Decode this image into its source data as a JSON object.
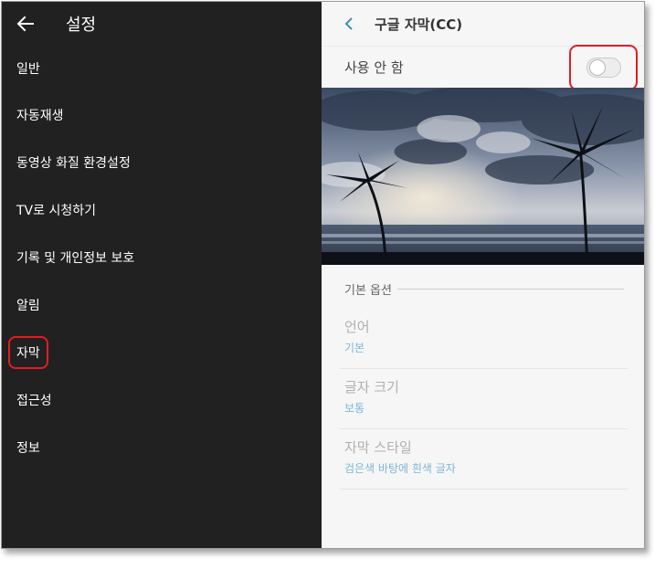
{
  "left": {
    "title": "설정",
    "items": [
      {
        "label": "일반"
      },
      {
        "label": "자동재생"
      },
      {
        "label": "동영상 화질 환경설정"
      },
      {
        "label": "TV로 시청하기"
      },
      {
        "label": "기록 및 개인정보 보호"
      },
      {
        "label": "알림"
      },
      {
        "label": "자막"
      },
      {
        "label": "접근성"
      },
      {
        "label": "정보"
      }
    ]
  },
  "right": {
    "title": "구글 자막(CC)",
    "toggle": {
      "label": "사용 안 함",
      "on": false
    },
    "section_label": "기본 옵션",
    "options": [
      {
        "title": "언어",
        "value": "기본"
      },
      {
        "title": "글자 크기",
        "value": "보통"
      },
      {
        "title": "자막 스타일",
        "value": "검은색 바탕에 흰색 글자"
      }
    ]
  },
  "colors": {
    "left_bg": "#212121",
    "right_bg": "#f6f6f6",
    "highlight": "#e51c23",
    "accent": "#7db6d8"
  },
  "icons": [
    "back-arrow-icon",
    "chevron-left-icon"
  ]
}
